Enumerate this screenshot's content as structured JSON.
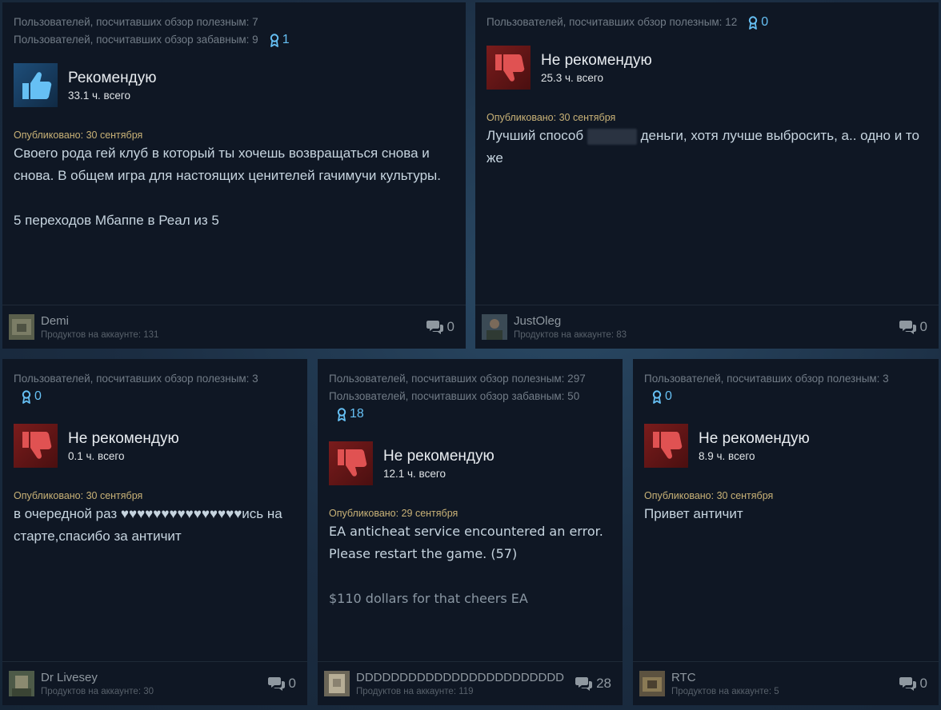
{
  "colors": {
    "accent": "#66c0f4",
    "recommend_bg": "#1e4e7a",
    "not_recommend_bg": "#7a1c1c",
    "card_bg": "#0f1724"
  },
  "reviews": [
    {
      "helpful": "Пользователей, посчитавших обзор полезным: 7",
      "funny": "Пользователей, посчитавших обзор забавным: 9",
      "awards": "1",
      "verdict": "Рекомендую",
      "hours": "33.1 ч. всего",
      "posted": "Опубликовано: 30 сентября",
      "text": [
        "Своего рода гей клуб в который ты хочешь возвращаться снова и снова. В общем игра для настоящих ценителей гачимучи культуры.",
        "5 переходов Мбаппе в Реал из 5"
      ],
      "user": "Demi",
      "products": "Продуктов на аккаунте: 131",
      "comments": "0"
    },
    {
      "helpful": "Пользователей, посчитавших обзор полезным: 12",
      "awards": "0",
      "verdict": "Не рекомендую",
      "hours": "25.3 ч. всего",
      "posted": "Опубликовано: 30 сентября",
      "text_before": "Лучший способ",
      "text_after": "деньги, хотя лучше выбросить, а.. одно и то же",
      "user": "JustOleg",
      "products": "Продуктов на аккаунте: 83",
      "comments": "0"
    },
    {
      "helpful": "Пользователей, посчитавших обзор полезным: 3",
      "awards": "0",
      "verdict": "Не рекомендую",
      "hours": "0.1 ч. всего",
      "posted": "Опубликовано: 30 сентября",
      "text": "в очередной раз ♥♥♥♥♥♥♥♥♥♥♥♥♥♥♥ись на старте,спасибо за античит",
      "user": "Dr Livesey",
      "products": "Продуктов на аккаунте: 30",
      "comments": "0"
    },
    {
      "helpful": "Пользователей, посчитавших обзор полезным: 297",
      "funny": "Пользователей, посчитавших обзор забавным: 50",
      "awards": "18",
      "verdict": "Не рекомендую",
      "hours": "12.1 ч. всего",
      "posted": "Опубликовано: 29 сентября",
      "text": [
        "EA anticheat service encountered an error. Please restart the game. (57)",
        "$110 dollars for that cheers EA"
      ],
      "user": "DDDDDDDDDDDDDDDDDDDDDDDD",
      "products": "Продуктов на аккаунте: 119",
      "comments": "28"
    },
    {
      "helpful": "Пользователей, посчитавших обзор полезным: 3",
      "awards": "0",
      "verdict": "Не рекомендую",
      "hours": "8.9 ч. всего",
      "posted": "Опубликовано: 30 сентября",
      "text": "Привет античит",
      "user": "RTC",
      "products": "Продуктов на аккаунте: 5",
      "comments": "0"
    }
  ]
}
